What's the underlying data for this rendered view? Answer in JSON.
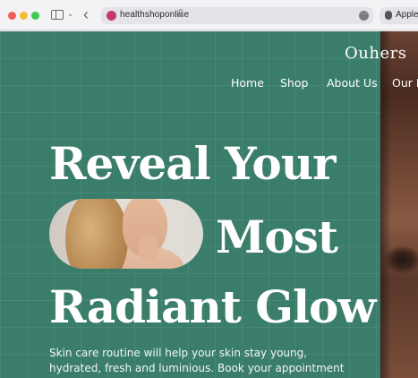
{
  "browser": {
    "url": "healthshoponline",
    "favorites": [
      {
        "label": "Apple"
      }
    ]
  },
  "site": {
    "brand": "Ouhers",
    "nav": [
      {
        "label": "Home"
      },
      {
        "label": "Shop"
      },
      {
        "label": "About Us"
      },
      {
        "label": "Our F"
      }
    ]
  },
  "hero": {
    "headline_line1": "Reveal Your",
    "headline_line2": "Most",
    "headline_line3": "Radiant Glow",
    "body": "Skin care routine will help your skin stay young, hydrated, fresh and luminious. Book your appointment now and get"
  },
  "colors": {
    "background": "#3a7d6b",
    "text": "#ffffff"
  }
}
